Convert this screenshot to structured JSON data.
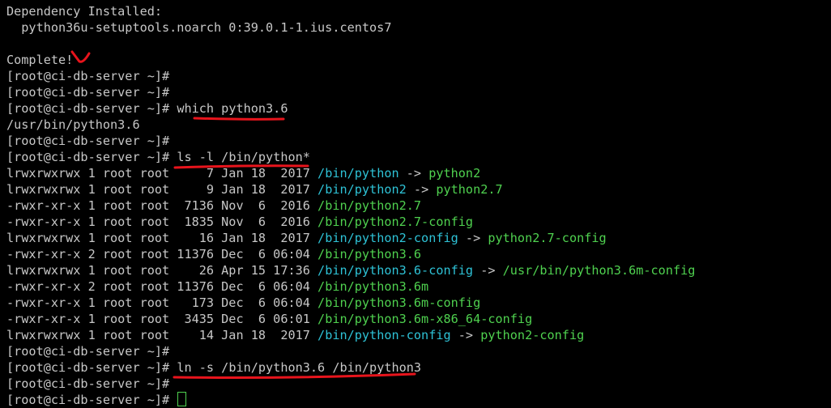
{
  "colors": {
    "background": "#000000",
    "text": "#c7c7c7",
    "symlink": "#2ec2d6",
    "executable": "#4fd14f",
    "annotation": "#e8141c"
  },
  "lines": [
    {
      "kind": "text",
      "text": "Dependency Installed:"
    },
    {
      "kind": "text",
      "text": "  python36u-setuptools.noarch 0:39.0.1-1.ius.centos7"
    },
    {
      "kind": "text",
      "text": ""
    },
    {
      "kind": "text",
      "text": "Complete!"
    },
    {
      "kind": "prompt",
      "prompt": "[root@ci-db-server ~]#",
      "cmd": ""
    },
    {
      "kind": "prompt",
      "prompt": "[root@ci-db-server ~]#",
      "cmd": ""
    },
    {
      "kind": "prompt",
      "prompt": "[root@ci-db-server ~]#",
      "cmd": " which python3.6"
    },
    {
      "kind": "text",
      "text": "/usr/bin/python3.6"
    },
    {
      "kind": "prompt",
      "prompt": "[root@ci-db-server ~]#",
      "cmd": ""
    },
    {
      "kind": "prompt",
      "prompt": "[root@ci-db-server ~]#",
      "cmd": " ls -l /bin/python*"
    },
    {
      "kind": "ls",
      "meta": "lrwxrwxrwx 1 root root     7 Jan 18  2017 ",
      "name": "/bin/python",
      "arrow": " -> ",
      "target": "python2",
      "type": "link"
    },
    {
      "kind": "ls",
      "meta": "lrwxrwxrwx 1 root root     9 Jan 18  2017 ",
      "name": "/bin/python2",
      "arrow": " -> ",
      "target": "python2.7",
      "type": "link"
    },
    {
      "kind": "ls",
      "meta": "-rwxr-xr-x 1 root root  7136 Nov  6  2016 ",
      "name": "/bin/python2.7",
      "arrow": "",
      "target": "",
      "type": "exec"
    },
    {
      "kind": "ls",
      "meta": "-rwxr-xr-x 1 root root  1835 Nov  6  2016 ",
      "name": "/bin/python2.7-config",
      "arrow": "",
      "target": "",
      "type": "exec"
    },
    {
      "kind": "ls",
      "meta": "lrwxrwxrwx 1 root root    16 Jan 18  2017 ",
      "name": "/bin/python2-config",
      "arrow": " -> ",
      "target": "python2.7-config",
      "type": "link"
    },
    {
      "kind": "ls",
      "meta": "-rwxr-xr-x 2 root root 11376 Dec  6 06:04 ",
      "name": "/bin/python3.6",
      "arrow": "",
      "target": "",
      "type": "exec"
    },
    {
      "kind": "ls",
      "meta": "lrwxrwxrwx 1 root root    26 Apr 15 17:36 ",
      "name": "/bin/python3.6-config",
      "arrow": " -> ",
      "target": "/usr/bin/python3.6m-config",
      "type": "link"
    },
    {
      "kind": "ls",
      "meta": "-rwxr-xr-x 2 root root 11376 Dec  6 06:04 ",
      "name": "/bin/python3.6m",
      "arrow": "",
      "target": "",
      "type": "exec"
    },
    {
      "kind": "ls",
      "meta": "-rwxr-xr-x 1 root root   173 Dec  6 06:04 ",
      "name": "/bin/python3.6m-config",
      "arrow": "",
      "target": "",
      "type": "exec"
    },
    {
      "kind": "ls",
      "meta": "-rwxr-xr-x 1 root root  3435 Dec  6 06:01 ",
      "name": "/bin/python3.6m-x86_64-config",
      "arrow": "",
      "target": "",
      "type": "exec"
    },
    {
      "kind": "ls",
      "meta": "lrwxrwxrwx 1 root root    14 Jan 18  2017 ",
      "name": "/bin/python-config",
      "arrow": " -> ",
      "target": "python2-config",
      "type": "link"
    },
    {
      "kind": "prompt",
      "prompt": "[root@ci-db-server ~]#",
      "cmd": ""
    },
    {
      "kind": "prompt",
      "prompt": "[root@ci-db-server ~]#",
      "cmd": " ln -s /bin/python3.6 /bin/python3"
    },
    {
      "kind": "prompt",
      "prompt": "[root@ci-db-server ~]#",
      "cmd": ""
    },
    {
      "kind": "prompt",
      "prompt": "[root@ci-db-server ~]#",
      "cmd": " ",
      "cursor": true
    }
  ]
}
